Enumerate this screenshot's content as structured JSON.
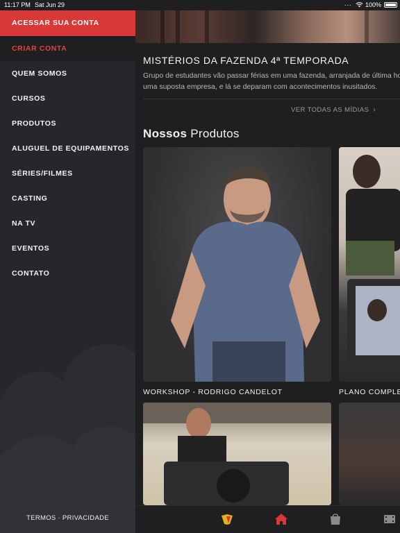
{
  "status_bar": {
    "time": "11:17 PM",
    "date": "Sat Jun 29",
    "signal_dots": "...",
    "battery": "100%"
  },
  "sidebar": {
    "items": [
      {
        "label": "ACESSAR SUA CONTA",
        "style": "primary"
      },
      {
        "label": "CRIAR CONTA",
        "style": "secondary"
      },
      {
        "label": "QUEM SOMOS"
      },
      {
        "label": "CURSOS"
      },
      {
        "label": "PRODUTOS"
      },
      {
        "label": "ALUGUEL DE EQUIPAMENTOS"
      },
      {
        "label": "SÉRIES/FILMES"
      },
      {
        "label": "CASTING"
      },
      {
        "label": "NA TV"
      },
      {
        "label": "EVENTOS"
      },
      {
        "label": "CONTATO"
      }
    ],
    "legal": "TERMOS · PRIVACIDADE"
  },
  "main": {
    "media": {
      "title": "MISTÉRIOS DA FAZENDA 4ª TEMPORADA",
      "description_line1": "Grupo de estudantes vão passar férias em uma fazenda, arranjada de última hora por",
      "description_line2": "uma suposta empresa, e lá se deparam com acontecimentos inusitados."
    },
    "see_all": "VER TODAS AS MÍDIAS",
    "products_heading_bold": "Nossos",
    "products_heading_rest": " Produtos",
    "products": [
      {
        "caption": "WORKSHOP - RODRIGO CANDELOT"
      },
      {
        "caption": "PLANO COMPLETO"
      },
      {
        "caption": ""
      },
      {
        "caption": ""
      }
    ]
  },
  "tabbar": {
    "tabs": [
      "logo-tab",
      "home-tab",
      "store-tab",
      "media-tab"
    ],
    "active": "home-tab"
  },
  "colors": {
    "accent": "#d93838",
    "sidebar_bg": "#27272b",
    "main_bg": "#1f1f21"
  }
}
